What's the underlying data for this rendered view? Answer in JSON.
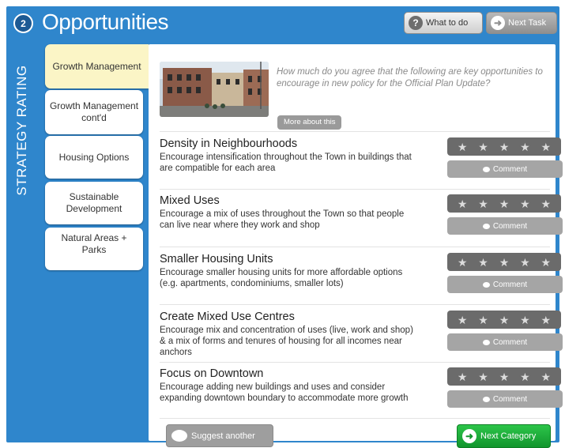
{
  "header": {
    "step": "2",
    "title": "Opportunities",
    "what_to_do_label": "What to do",
    "what_to_do_icon": "help-icon",
    "next_task_label": "Next Task",
    "next_task_icon": "arrow-right-circle-icon"
  },
  "side_label": "STRATEGY RATING",
  "nav": {
    "items": [
      {
        "label": "Growth Management",
        "active": true
      },
      {
        "label": "Growth Management cont'd",
        "active": false
      },
      {
        "label": "Housing Options",
        "active": false
      },
      {
        "label": "Sustainable Development",
        "active": false
      },
      {
        "label": "Natural Areas + Parks",
        "active": false
      }
    ]
  },
  "intro": {
    "question": "How much do you agree that the following are key opportunities to encourage in new policy for the Official Plan Update?",
    "more_label": "More about this"
  },
  "opportunities": [
    {
      "title": "Density in Neighbourhoods",
      "description": "Encourage intensification throughout the Town in buildings that are compatible for each area",
      "comment_label": "Comment"
    },
    {
      "title": "Mixed Uses",
      "description": "Encourage a mix of uses throughout the Town so that people can live near where they work and shop",
      "comment_label": "Comment"
    },
    {
      "title": "Smaller Housing Units",
      "description": "Encourage smaller housing units for more affordable options (e.g. apartments, condominiums, smaller lots)",
      "comment_label": "Comment"
    },
    {
      "title": "Create Mixed Use Centres",
      "description": "Encourage mix and concentration of uses (live, work and shop) &  a mix of forms and tenures of housing for all incomes near anchors",
      "comment_label": "Comment"
    },
    {
      "title": "Focus on Downtown",
      "description": "Encourage adding new buildings and uses and consider expanding downtown boundary to accommodate more growth",
      "comment_label": "Comment"
    }
  ],
  "rating": {
    "max_stars": 5,
    "selected": 0
  },
  "footer": {
    "suggest_label": "Suggest another",
    "next_category_label": "Next Category"
  },
  "colors": {
    "frame": "#2f86cc",
    "active_tab": "#fbf5c6",
    "next_category": "#12952d",
    "stars_bg": "#6b6b6b",
    "comment_bg": "#a5a5a5"
  }
}
